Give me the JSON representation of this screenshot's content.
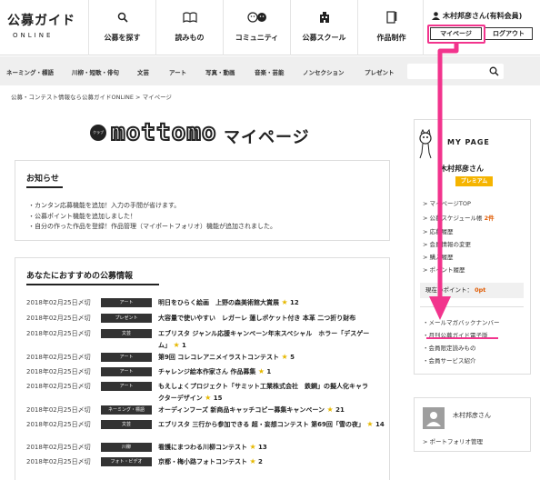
{
  "header": {
    "logo_main": "公募ガイド",
    "logo_sub": "ONLINE",
    "nav": [
      {
        "label": "公募を探す",
        "icon": "search-icon"
      },
      {
        "label": "読みもの",
        "icon": "book-icon"
      },
      {
        "label": "コミュニティ",
        "icon": "faces-icon"
      },
      {
        "label": "公募スクール",
        "icon": "building-icon"
      },
      {
        "label": "作品制作",
        "icon": "pen-notebook-icon"
      }
    ],
    "user_name": "木村邦彦さん(有料会員)",
    "mypage_button": "マイページ",
    "logout_button": "ログアウト"
  },
  "categories": [
    "ネーミング・標語",
    "川柳・短歌・俳句",
    "文芸",
    "アート",
    "写真・動画",
    "音楽・芸能",
    "ノンセクション",
    "プレゼント"
  ],
  "search": {
    "placeholder": ""
  },
  "breadcrumb": "公募・コンテスト情報なら公募ガイドONLINE > マイページ",
  "page_title": {
    "badge": "クラブ",
    "logo": "mottomo",
    "title": "マイページ"
  },
  "notice": {
    "title": "お知らせ",
    "items": [
      "・カンタン応募機能を追加！入力の手間が省けます。",
      "・公募ポイント機能を追加しました！",
      "・自分の作った作品を登録！作品管理（マイポートフォリオ）機能が追加されました。"
    ]
  },
  "recommend": {
    "title": "あなたにおすすめの公募情報",
    "rows": [
      {
        "date": "2018年02月25日〆切",
        "category": "アート",
        "title": "明日をひらく絵画　上野の森美術館大賞展",
        "title2": "",
        "stars": "12"
      },
      {
        "date": "2018年02月25日〆切",
        "category": "プレゼント",
        "title": "大容量で使いやすい　レガーレ 蓮しポケット付き 本革 二つ折り財布",
        "title2": "",
        "stars": ""
      },
      {
        "date": "2018年02月25日〆切",
        "category": "文芸",
        "title": "エブリスタ ジャンル応援キャンペーン年末スペシャル　ホラー「デスゲー",
        "title2": "ム」",
        "stars": "1"
      },
      {
        "date": "2018年02月25日〆切",
        "category": "アート",
        "title": "第9回 コレコレアニメイラストコンテスト",
        "title2": "",
        "stars": "5"
      },
      {
        "date": "2018年02月25日〆切",
        "category": "アート",
        "title": "チャレンジ絵本作家さん 作品募集",
        "title2": "",
        "stars": "1"
      },
      {
        "date": "2018年02月25日〆切",
        "category": "アート",
        "title": "もえしょくプロジェクト「サミット工業株式会社　鉄鋼」の擬人化キャラ",
        "title2": "クターデザイン",
        "stars": "15"
      },
      {
        "date": "2018年02月25日〆切",
        "category": "ネーミング・標語",
        "title": "オーディンフーズ 新商品キャッチコピー募集キャンペーン",
        "title2": "",
        "stars": "21"
      },
      {
        "date": "2018年02月25日〆切",
        "category": "文芸",
        "title": "エブリスタ 三行から参加できる 超・妄想コンテスト 第69回「雪の夜」",
        "title2": "",
        "stars": "14"
      },
      {
        "date": "2018年02月25日〆切",
        "category": "川柳",
        "title": "看護にまつわる川柳コンテスト",
        "title2": "",
        "stars": "13"
      },
      {
        "date": "2018年02月25日〆切",
        "category": "フォト・ビデオ",
        "title": "京都・梅小路フォトコンテスト",
        "title2": "",
        "stars": "2"
      }
    ]
  },
  "sidebar": {
    "heading": "MY PAGE",
    "name": "木村邦彦さん",
    "badge": "プレミアム",
    "links": [
      "マイページTOP",
      "公募スケジュール帳",
      "応募履歴",
      "会員情報の変更",
      "購入履歴",
      "ポイント履歴"
    ],
    "schedule_count": "2件",
    "points_label": "現在のポイント：",
    "points_value": "0pt",
    "links2": [
      "メールマガバックナンバー",
      "月刊公募ガイド電子版",
      "会員限定読みもの",
      "会員サービス紹介"
    ]
  },
  "sidebar2": {
    "name": "木村邦彦さん",
    "link": "ポートフォリオ管理"
  },
  "colors": {
    "highlight": "#f2348d",
    "premium": "#f5b400",
    "points": "#e05a00",
    "category_bg": "#333333"
  }
}
